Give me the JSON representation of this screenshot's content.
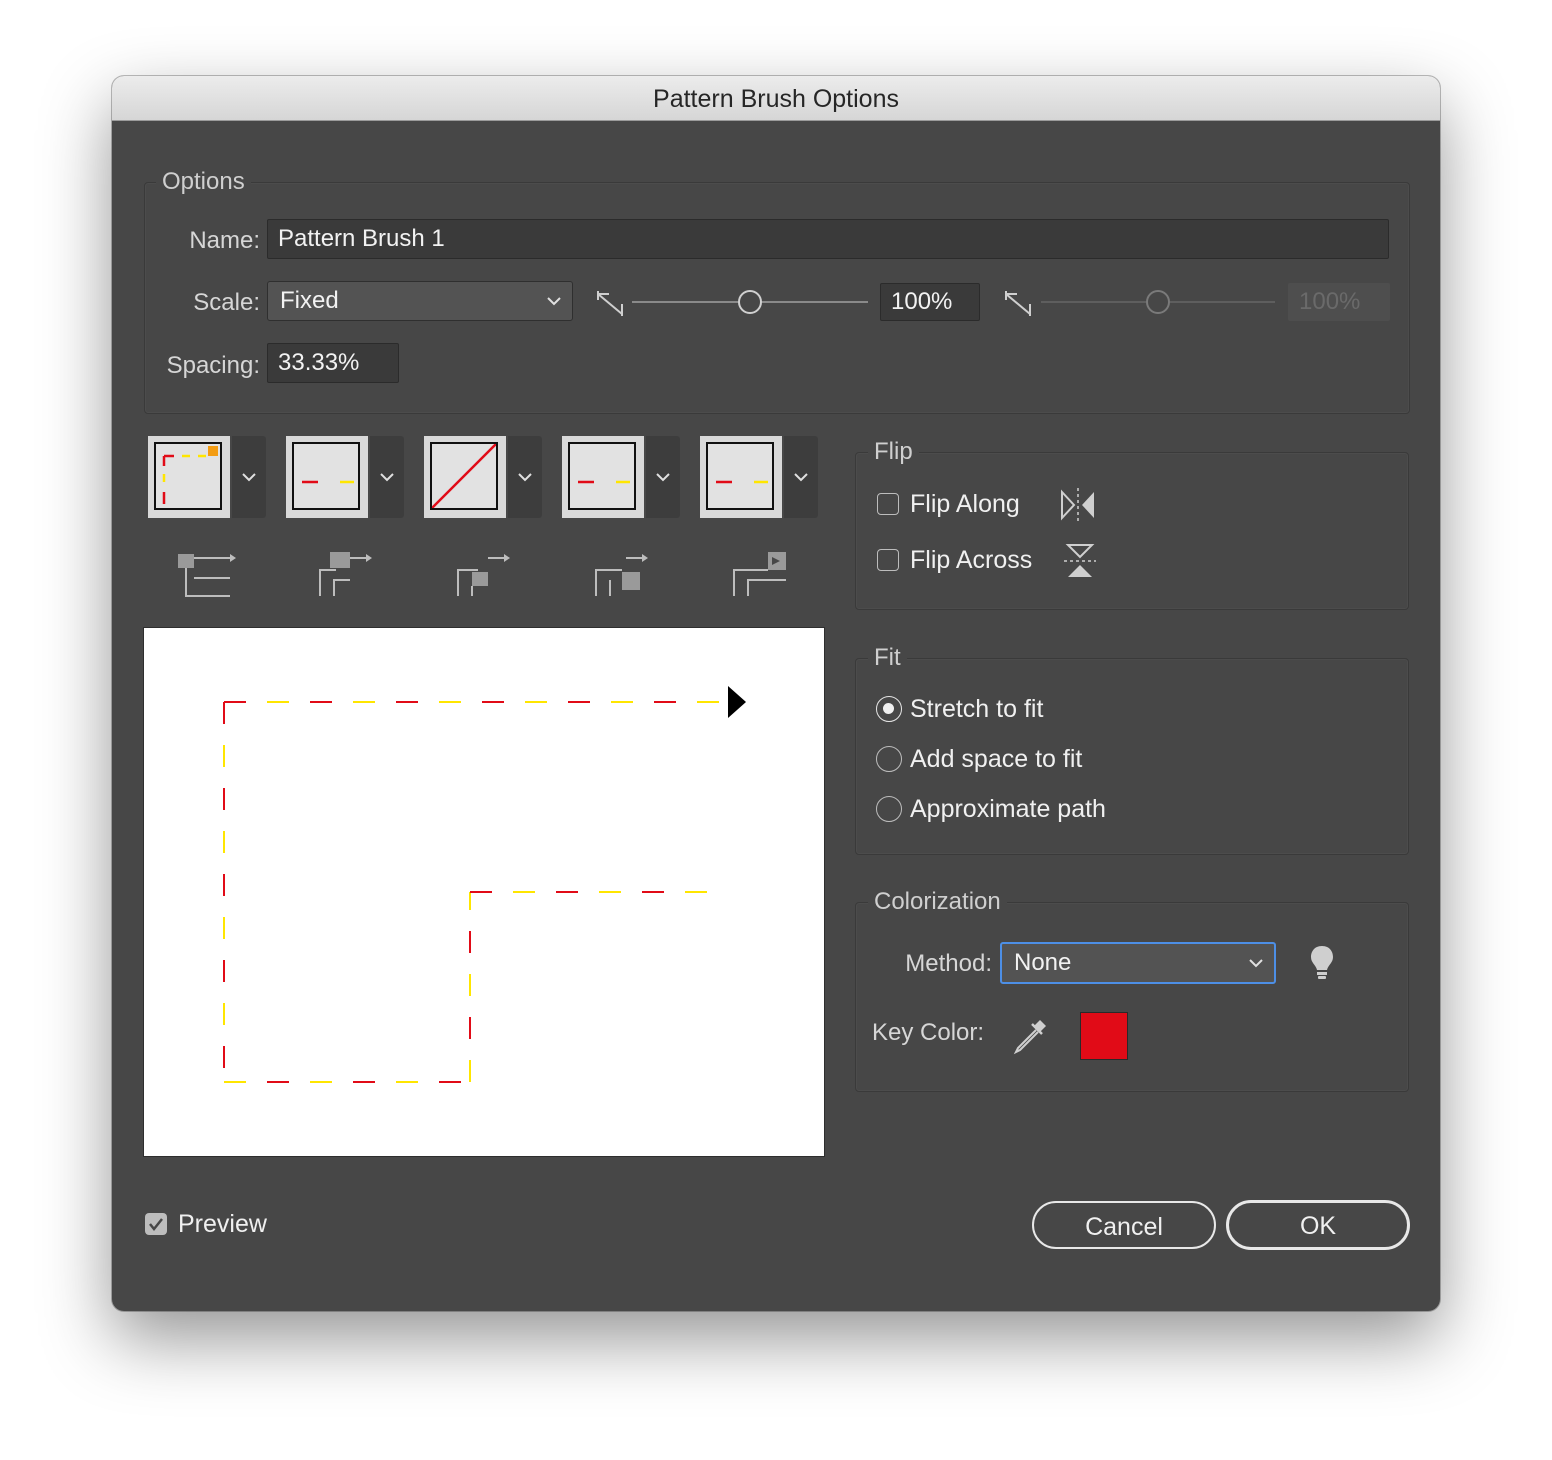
{
  "window": {
    "title": "Pattern Brush Options"
  },
  "options": {
    "legend": "Options",
    "name_label": "Name:",
    "name_value": "Pattern Brush 1",
    "scale_label": "Scale:",
    "scale_value": "Fixed",
    "scale_min_value": "100%",
    "scale_max_value": "100%",
    "spacing_label": "Spacing:",
    "spacing_value": "33.33%"
  },
  "tiles": [
    {
      "name": "outer-corner-tile"
    },
    {
      "name": "side-tile"
    },
    {
      "name": "inner-corner-tile"
    },
    {
      "name": "start-tile"
    },
    {
      "name": "end-tile"
    }
  ],
  "flip": {
    "legend": "Flip",
    "along_label": "Flip Along",
    "along_checked": false,
    "across_label": "Flip Across",
    "across_checked": false
  },
  "fit": {
    "legend": "Fit",
    "options": [
      "Stretch to fit",
      "Add space to fit",
      "Approximate path"
    ],
    "selected_index": 0
  },
  "colorization": {
    "legend": "Colorization",
    "method_label": "Method:",
    "method_value": "None",
    "key_color_label": "Key Color:",
    "key_color": "#e10b17"
  },
  "preview": {
    "label": "Preview",
    "checked": true
  },
  "buttons": {
    "cancel": "Cancel",
    "ok": "OK"
  },
  "colors": {
    "accent": "#4d8fe6",
    "dash_red": "#e10b17",
    "dash_yellow": "#ffe600"
  }
}
